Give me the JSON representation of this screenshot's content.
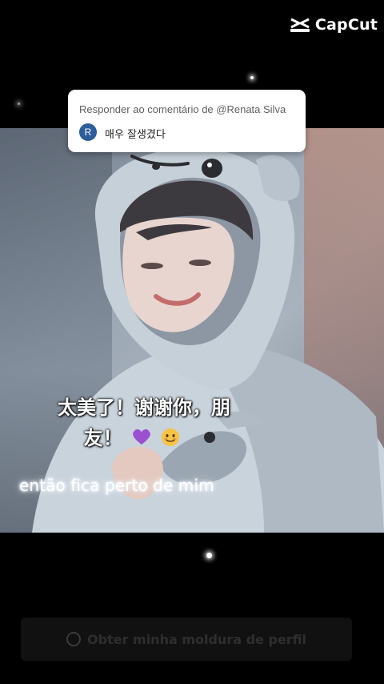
{
  "watermark": {
    "brand": "CapCut",
    "icon": "capcut-logo-icon"
  },
  "reply_bubble": {
    "label": "Responder ao comentário de @Renata Silva",
    "avatar_initial": "R",
    "comment": "매우 잘생겼다"
  },
  "captions": {
    "chinese_line1": "太美了！谢谢你，朋",
    "chinese_line2": "友！",
    "emojis": [
      "purple-heart-icon",
      "smiling-face-icon"
    ],
    "portuguese": "então fica perto de mim"
  },
  "frame_button": {
    "label": "Obter minha moldura de perfil",
    "icon": "circle-icon"
  },
  "colors": {
    "background": "#000000",
    "avatar": "#2c5d9c",
    "bubble": "#ffffff"
  }
}
